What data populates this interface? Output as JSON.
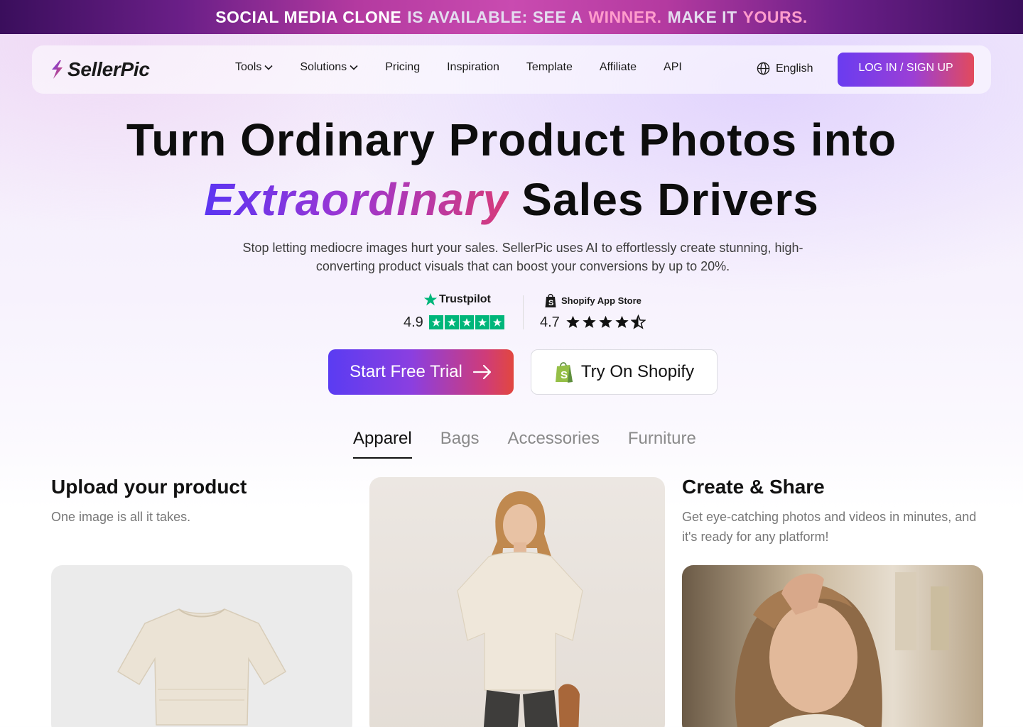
{
  "banner": {
    "part1": "SOCIAL MEDIA CLONE",
    "part2": "IS AVAILABLE: SEE A",
    "part3": "WINNER.",
    "part4": "MAKE IT",
    "part5": "YOURS."
  },
  "nav": {
    "logo_text": "SellerPic",
    "items": [
      {
        "label": "Tools",
        "dropdown": true
      },
      {
        "label": "Solutions",
        "dropdown": true
      },
      {
        "label": "Pricing"
      },
      {
        "label": "Inspiration"
      },
      {
        "label": "Template"
      },
      {
        "label": "Affiliate"
      },
      {
        "label": "API"
      }
    ],
    "language": "English",
    "login_label": "LOG IN / SIGN UP"
  },
  "hero": {
    "line1": "Turn Ordinary Product Photos into",
    "accent": "Extraordinary",
    "line2_rest": "Sales Drivers",
    "subtitle": "Stop letting mediocre images hurt your sales. SellerPic uses AI to effortlessly create stunning, high-converting product visuals that can boost your conversions by up to 20%."
  },
  "ratings": {
    "trustpilot": {
      "brand": "Trustpilot",
      "score": "4.9",
      "stars": 5
    },
    "shopify": {
      "brand": "Shopify App Store",
      "score": "4.7",
      "stars": 4.5
    }
  },
  "cta": {
    "trial_label": "Start Free Trial",
    "shopify_label": "Try On Shopify"
  },
  "tabs": [
    {
      "label": "Apparel",
      "active": true
    },
    {
      "label": "Bags"
    },
    {
      "label": "Accessories"
    },
    {
      "label": "Furniture"
    }
  ],
  "steps": {
    "upload": {
      "title": "Upload your product",
      "desc": "One image is all it takes."
    },
    "create": {
      "title": "Create & Share",
      "desc": "Get eye-catching photos and videos in minutes, and it's ready for any platform!"
    }
  },
  "colors": {
    "accent_purple": "#6a3cf0",
    "accent_red": "#e24a5c",
    "trustpilot_green": "#00b67a",
    "shopify_green": "#95bf47"
  }
}
